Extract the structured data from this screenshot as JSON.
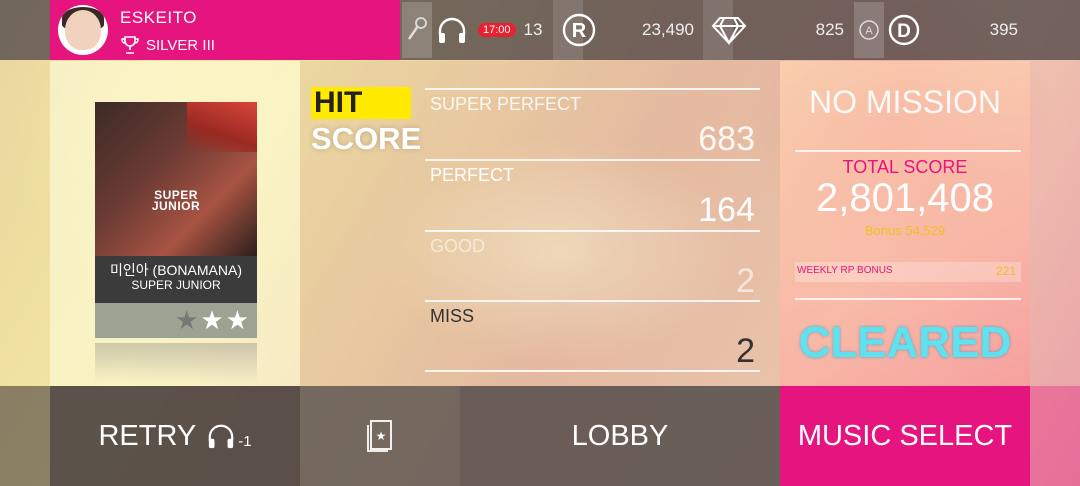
{
  "profile": {
    "name": "ESKEITO",
    "rank": "SILVER III"
  },
  "status": {
    "timer": "17:00",
    "headphones": "13",
    "rp": "23,490",
    "diamonds": "825",
    "points": "395"
  },
  "hit_score": {
    "line1": "HIT",
    "line2": "SCORE"
  },
  "song": {
    "title": "미인아 (BONAMANA)",
    "artist": "SUPER JUNIOR",
    "album_logo": "SUPER JUNIOR",
    "stars_filled": 2,
    "stars_total": 3
  },
  "results": [
    {
      "label": "SUPER PERFECT",
      "value": "683"
    },
    {
      "label": "PERFECT",
      "value": "164"
    },
    {
      "label": "GOOD",
      "value": "2"
    },
    {
      "label": "MISS",
      "value": "2"
    }
  ],
  "mission": {
    "text": "NO MISSION"
  },
  "total": {
    "label": "TOTAL SCORE",
    "value": "2,801,408",
    "bonus": "Bonus 54,529"
  },
  "weekly": {
    "label": "WEEKLY RP BONUS",
    "value": "221"
  },
  "cleared": "CLEARED",
  "buttons": {
    "retry": "RETRY",
    "retry_cost": "-1",
    "lobby": "LOBBY",
    "music_select": "MUSIC SELECT"
  }
}
